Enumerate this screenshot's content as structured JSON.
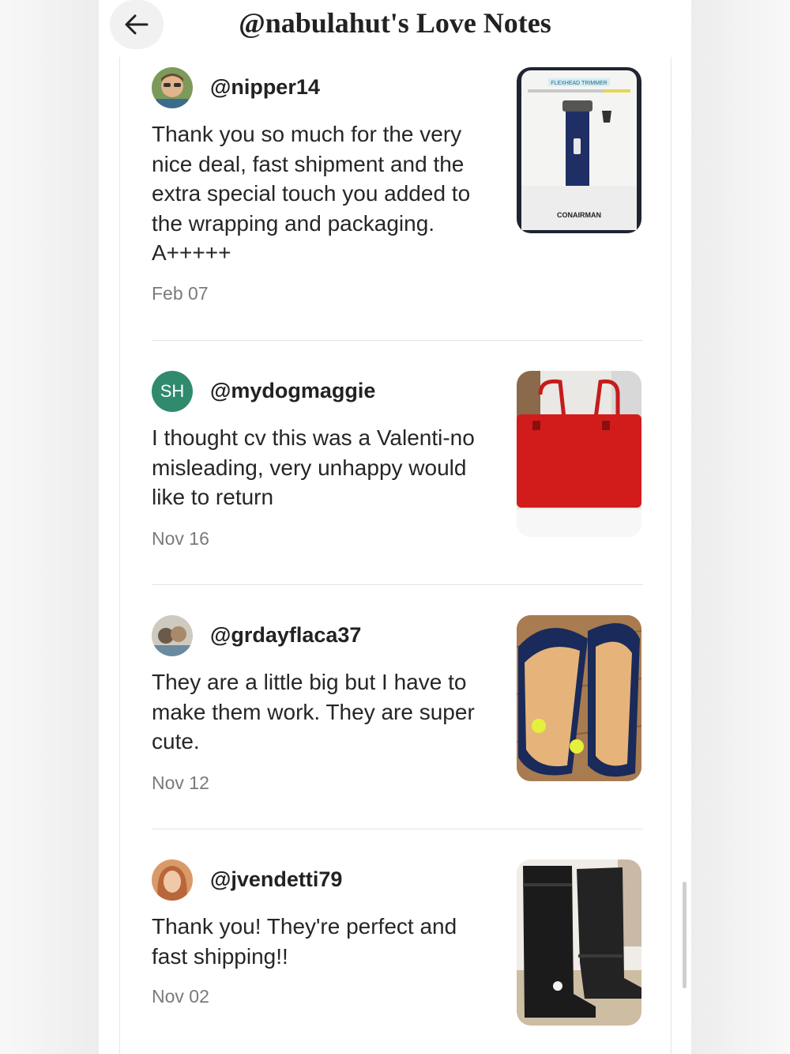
{
  "header": {
    "title": "@nabulahut's Love Notes",
    "back_icon": "arrow-left-icon"
  },
  "notes": [
    {
      "username": "@nipper14",
      "message": "Thank you so much for the very nice deal, fast shipment and the extra special touch you added to the wrapping and packaging. A+++++",
      "date": "Feb 07",
      "image": "conair-trimmer"
    },
    {
      "username": "@mydogmaggie",
      "initials": "SH",
      "message": "I thought cv this was a Valenti-no misleading, very unhappy would like to return",
      "date": "Nov 16",
      "image": "red-handbag"
    },
    {
      "username": "@grdayflaca37",
      "message": "They are a little big but I have to make them work. They are super cute.",
      "date": "Nov 12",
      "image": "sequin-flats"
    },
    {
      "username": "@jvendetti79",
      "message": "Thank you! They're perfect and fast shipping!!",
      "date": "Nov 02",
      "image": "black-boots"
    }
  ],
  "product_labels": {
    "brand": "CONAIRMAN",
    "product": "FLEXHEAD TRIMMER"
  },
  "colors": {
    "accent_initials_bg": "#2f8a6e",
    "date_text": "#7a7a7a"
  }
}
